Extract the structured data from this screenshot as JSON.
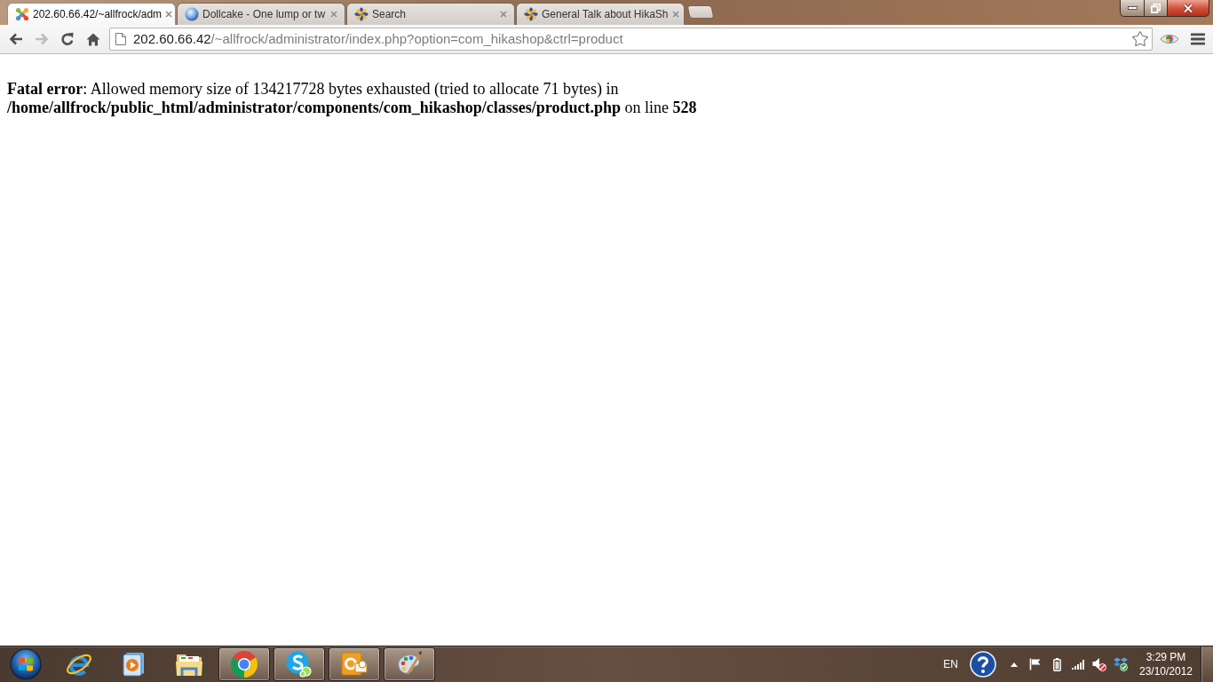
{
  "tabs": [
    {
      "title": "202.60.66.42/~allfrock/adm",
      "kind": "four-color",
      "selected": true
    },
    {
      "title": "Dollcake - One lump or tw",
      "kind": "sphere",
      "selected": false
    },
    {
      "title": "Search",
      "kind": "pinwheel",
      "selected": false
    },
    {
      "title": "General Talk about HikaSh",
      "kind": "pinwheel",
      "selected": false
    }
  ],
  "toolbar": {
    "buttons": [
      {
        "kind": "back",
        "disabled": false
      },
      {
        "kind": "forward",
        "disabled": true
      },
      {
        "kind": "reload",
        "disabled": false
      },
      {
        "kind": "home",
        "disabled": false
      }
    ],
    "address": {
      "host": "202.60.66.42",
      "path": "/~allfrock/administrator/index.php?option=com_hikashop&ctrl=product"
    },
    "bookmarked": false
  },
  "page": {
    "message": "**Fatal error**: Allowed memory size of 134217728 bytes exhausted (tried to allocate 71 bytes) in **/home/allfrock/public_html/administrator/components/com_hikashop/classes/product.php** on line **528**"
  },
  "taskbar": {
    "apps": [
      {
        "kind": "e-browser",
        "running": false
      },
      {
        "kind": "media-player",
        "running": false
      },
      {
        "kind": "folder",
        "running": false
      },
      {
        "kind": "ring-browser",
        "running": true
      },
      {
        "kind": "chat",
        "running": true
      },
      {
        "kind": "mail",
        "running": true
      },
      {
        "kind": "paint",
        "running": true
      }
    ],
    "language": "EN",
    "tray_icons": [
      {
        "kind": "help"
      },
      {
        "kind": "show-hidden"
      },
      {
        "kind": "flag"
      },
      {
        "kind": "battery"
      },
      {
        "kind": "signal"
      },
      {
        "kind": "volume-muted"
      },
      {
        "kind": "sync-box"
      }
    ],
    "clock": {
      "time": "3:29 PM",
      "date": "23/10/2012"
    }
  }
}
